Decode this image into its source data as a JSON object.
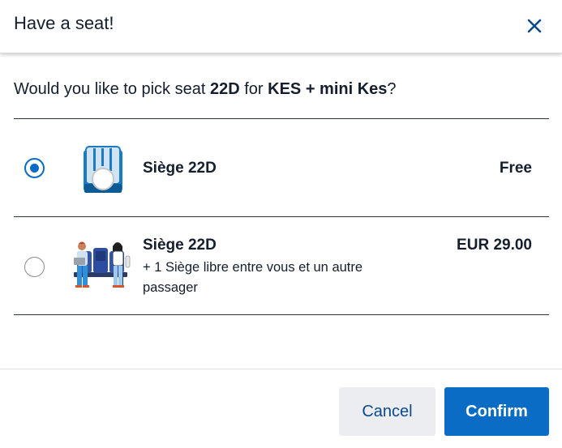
{
  "dialog": {
    "title": "Have a seat!",
    "close_icon": "close-icon"
  },
  "question": {
    "prefix": "Would you like to pick seat ",
    "seat": "22D",
    "middle": " for ",
    "passenger": "KES + mini Kes",
    "suffix": "?"
  },
  "options": [
    {
      "title": "Siège 22D",
      "price": "Free",
      "description": "",
      "selected": true,
      "icon": "single-seat-icon"
    },
    {
      "title": "Siège 22D",
      "price": "EUR 29.00",
      "description": "+ 1 Siège libre entre vous et un autre passager",
      "selected": false,
      "icon": "empty-seat-between-passengers-icon"
    }
  ],
  "footer": {
    "cancel_label": "Cancel",
    "confirm_label": "Confirm"
  },
  "colors": {
    "primary": "#0a6cc4",
    "text": "#141e2d",
    "cancel_bg": "#ebedf0",
    "cancel_text": "#0b4a8a"
  }
}
